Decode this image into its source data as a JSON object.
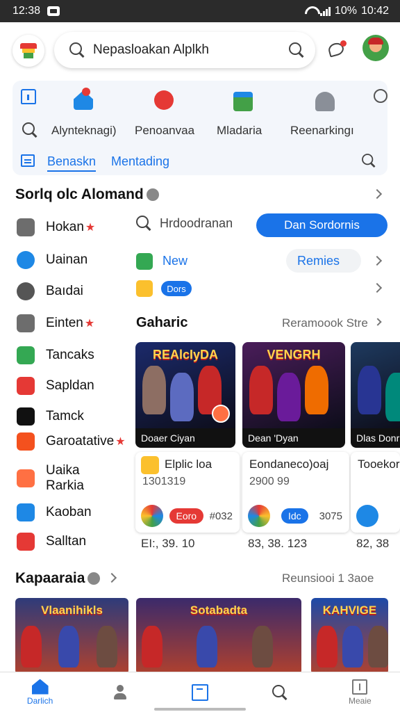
{
  "status_bar": {
    "time_left": "12:38",
    "battery": "10%",
    "time_right": "10:42"
  },
  "search": {
    "text": "Nepasloakan Alplkh"
  },
  "quick": {
    "labels": [
      "Alynteknagi)",
      "Penoanvaa",
      "Mladaria",
      "Reenarkingı"
    ],
    "tabs": [
      "Benaskn",
      "Mentading"
    ]
  },
  "section1": {
    "title": "Sorlq olc Alomand"
  },
  "menu": [
    {
      "label": "Hokan",
      "star": "★",
      "color": "#6d6d6d",
      "icon": "gear-icon"
    },
    {
      "label": "Uainan",
      "star": "",
      "color": "#1e88e5",
      "icon": "chat-icon"
    },
    {
      "label": "Baıdai",
      "star": "",
      "color": "#555555",
      "icon": "circle-icon"
    },
    {
      "label": "Einten",
      "star": "★",
      "color": "#6d6d6d",
      "icon": "grid-icon"
    },
    {
      "label": "Tancaks",
      "star": "",
      "color": "#34a853",
      "icon": "play-icon"
    },
    {
      "label": "Sapldan",
      "star": "",
      "color": "#e53935",
      "icon": "app-icon"
    },
    {
      "label": "Tamck",
      "star": "",
      "color": "#111111",
      "icon": "app-icon"
    },
    {
      "label": "Garoatative",
      "star": "★",
      "color": "#f4511e",
      "icon": "app-icon"
    },
    {
      "label": "Uaika Rarkia",
      "star": "",
      "color": "#ff7043",
      "icon": "app-icon"
    },
    {
      "label": "Kaoban",
      "star": "",
      "color": "#1e88e5",
      "icon": "app-icon"
    },
    {
      "label": "Salltan",
      "star": "",
      "color": "#e53935",
      "icon": "app-icon"
    }
  ],
  "right": {
    "search_chip": "Hrdoodranan",
    "primary_button": "Dan Sordornis",
    "new_label": "New",
    "remies_label": "Remies",
    "pill_label": "Dors"
  },
  "games": {
    "title": "Gaharic",
    "see_all": "Reramoook Stre",
    "cards": [
      {
        "art_title": "REAlcIyDA",
        "caption": "Doaer Ciyan",
        "name": "Elplic loa",
        "sub": "1301319",
        "chip": "Eoro",
        "extra": "#032",
        "price": "ΕΙ:, 39. 10",
        "bg": "#1b2a6b"
      },
      {
        "art_title": "VENGRH",
        "caption": "Dean 'Dyan",
        "name": "Eondaneco)oaj",
        "sub": "2900 99",
        "chip": "Idc",
        "extra": "3075",
        "price": "83, 38. 123",
        "bg": "#4a1d5a"
      },
      {
        "art_title": "",
        "caption": "Dlas Donr",
        "name": "Tooekor",
        "sub": "",
        "chip": "",
        "extra": "",
        "price": "82, 38",
        "bg": "#1e3a5f"
      }
    ]
  },
  "section2": {
    "title": "Kapaaraia",
    "see_all": "Reunsiooi 1 3aoe"
  },
  "strip": [
    {
      "title": "Vlaanihikls",
      "bg": "#2e3b7a"
    },
    {
      "title": "Sotabadta",
      "bg": "#3b2a6b"
    },
    {
      "title": "KAHVIGE",
      "bg": "#1d4aa8"
    }
  ],
  "bottom_nav": {
    "home_label": "Darlich",
    "more_label": "Meaie"
  }
}
